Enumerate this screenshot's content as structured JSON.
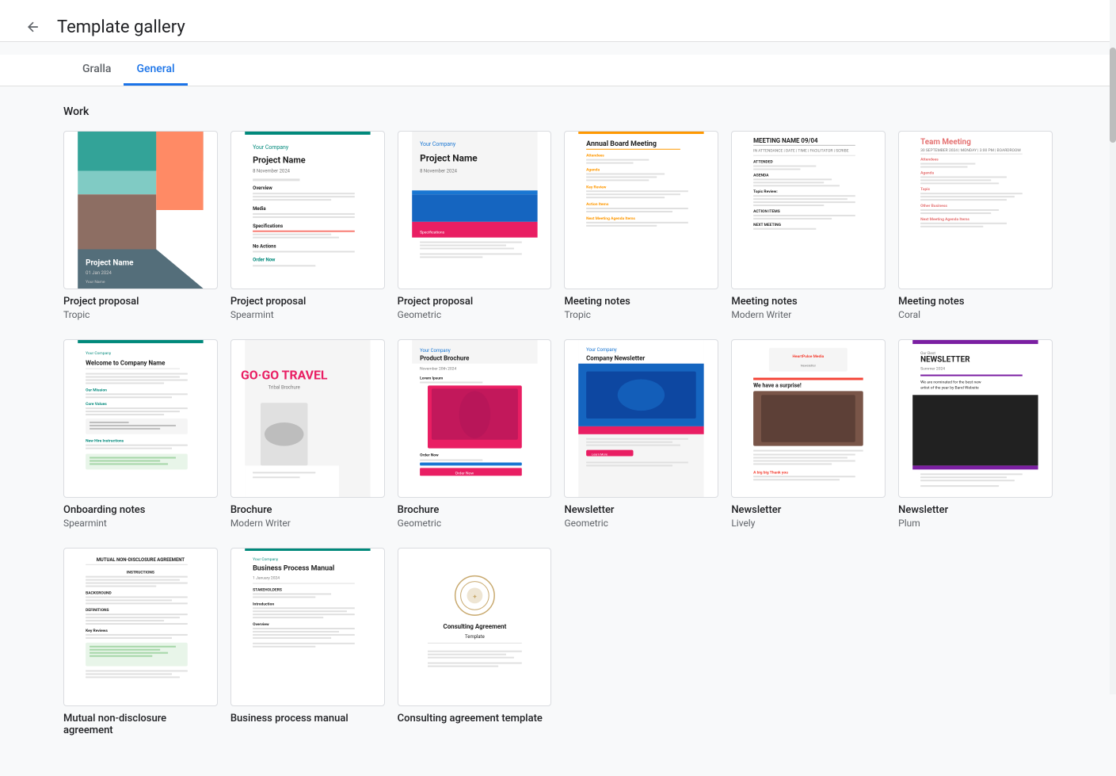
{
  "header": {
    "back_label": "←",
    "title": "Template gallery"
  },
  "tabs": [
    {
      "id": "gralla",
      "label": "Gralla",
      "active": false
    },
    {
      "id": "general",
      "label": "General",
      "active": true
    }
  ],
  "sections": [
    {
      "id": "work",
      "label": "Work",
      "templates": [
        {
          "id": "project-proposal-tropic",
          "name": "Project proposal",
          "sub": "Tropic",
          "thumb_type": "tropic"
        },
        {
          "id": "project-proposal-spearmint",
          "name": "Project proposal",
          "sub": "Spearmint",
          "thumb_type": "spearmint"
        },
        {
          "id": "project-proposal-geometric",
          "name": "Project proposal",
          "sub": "Geometric",
          "thumb_type": "geometric-proposal"
        },
        {
          "id": "meeting-notes-tropic",
          "name": "Meeting notes",
          "sub": "Tropic",
          "thumb_type": "meeting-tropic"
        },
        {
          "id": "meeting-notes-modern",
          "name": "Meeting notes",
          "sub": "Modern Writer",
          "thumb_type": "meeting-modern"
        },
        {
          "id": "meeting-notes-coral",
          "name": "Meeting notes",
          "sub": "Coral",
          "thumb_type": "meeting-coral"
        },
        {
          "id": "onboarding-spearmint",
          "name": "Onboarding notes",
          "sub": "Spearmint",
          "thumb_type": "onboarding"
        },
        {
          "id": "brochure-modern",
          "name": "Brochure",
          "sub": "Modern Writer",
          "thumb_type": "brochure-travel"
        },
        {
          "id": "brochure-geometric",
          "name": "Brochure",
          "sub": "Geometric",
          "thumb_type": "brochure-geometric"
        },
        {
          "id": "newsletter-geometric",
          "name": "Newsletter",
          "sub": "Geometric",
          "thumb_type": "newsletter-geometric"
        },
        {
          "id": "newsletter-lively",
          "name": "Newsletter",
          "sub": "Lively",
          "thumb_type": "newsletter-lively"
        },
        {
          "id": "newsletter-plum",
          "name": "Newsletter",
          "sub": "Plum",
          "thumb_type": "newsletter-plum"
        },
        {
          "id": "mutual-nda",
          "name": "Mutual non-disclosure agreement",
          "sub": "",
          "thumb_type": "nda"
        },
        {
          "id": "business-process",
          "name": "Business process manual",
          "sub": "",
          "thumb_type": "business-process"
        },
        {
          "id": "consulting-agreement",
          "name": "Consulting agreement template",
          "sub": "",
          "thumb_type": "consulting"
        }
      ]
    }
  ]
}
